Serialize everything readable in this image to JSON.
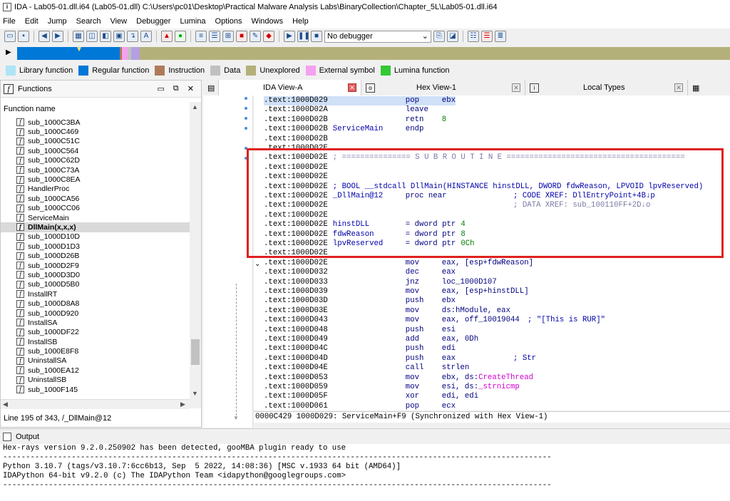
{
  "window": {
    "title": "IDA - Lab05-01.dll.i64 (Lab05-01.dll) C:\\Users\\pc01\\Desktop\\Practical Malware Analysis Labs\\BinaryCollection\\Chapter_5L\\Lab05-01.dll.i64"
  },
  "menu": [
    "File",
    "Edit",
    "Jump",
    "Search",
    "View",
    "Debugger",
    "Lumina",
    "Options",
    "Windows",
    "Help"
  ],
  "toolbar": {
    "debugger_select": "No debugger"
  },
  "legend": [
    {
      "label": "Library function",
      "color": "#aee4f5"
    },
    {
      "label": "Regular function",
      "color": "#0078d7"
    },
    {
      "label": "Instruction",
      "color": "#b07a5a"
    },
    {
      "label": "Data",
      "color": "#c0c0c0"
    },
    {
      "label": "Unexplored",
      "color": "#b4b07a"
    },
    {
      "label": "External symbol",
      "color": "#f5a0f0"
    },
    {
      "label": "Lumina function",
      "color": "#34c934"
    }
  ],
  "functions": {
    "title": "Functions",
    "column": "Function name",
    "items": [
      "sub_1000C3BA",
      "sub_1000C469",
      "sub_1000C51C",
      "sub_1000C564",
      "sub_1000C62D",
      "sub_1000C73A",
      "sub_1000C8EA",
      "HandlerProc",
      "sub_1000CA56",
      "sub_1000CC06",
      "ServiceMain",
      "DllMain(x,x,x)",
      "sub_1000D10D",
      "sub_1000D1D3",
      "sub_1000D26B",
      "sub_1000D2F9",
      "sub_1000D3D0",
      "sub_1000D5B0",
      "InstallRT",
      "sub_1000D8A8",
      "sub_1000D920",
      "InstallSA",
      "sub_1000DF22",
      "InstallSB",
      "sub_1000E8F8",
      "UninstallSA",
      "sub_1000EA12",
      "UninstallSB",
      "sub_1000F145"
    ],
    "selected_index": 11,
    "status": "Line 195 of 343, /_DllMain@12"
  },
  "tabs": [
    {
      "label": "IDA View-A",
      "active": true
    },
    {
      "label": "Hex View-1",
      "active": false
    },
    {
      "label": "Local Types",
      "active": false
    }
  ],
  "code": {
    "lines": [
      {
        "addr": ".text:1000D029",
        "label": "",
        "mn": "pop",
        "op": "ebx",
        "cm": ""
      },
      {
        "addr": ".text:1000D02A",
        "label": "",
        "mn": "leave",
        "op": "",
        "cm": ""
      },
      {
        "addr": ".text:1000D02B",
        "label": "",
        "mn": "retn",
        "op": "8",
        "cm": ""
      },
      {
        "addr": ".text:1000D02B",
        "label": "ServiceMain",
        "mn": "endp",
        "op": "",
        "cm": ""
      },
      {
        "addr": ".text:1000D02B",
        "label": "",
        "mn": "",
        "op": "",
        "cm": ""
      },
      {
        "addr": ".text:1000D02E",
        "label": "",
        "mn": "",
        "op": "",
        "cm": ""
      },
      {
        "addr": ".text:1000D02E",
        "label": "",
        "mn": "",
        "op": "",
        "cm": "",
        "sub": "; =============== S U B R O U T I N E ======================================="
      },
      {
        "addr": ".text:1000D02E",
        "label": "",
        "mn": "",
        "op": "",
        "cm": ""
      },
      {
        "addr": ".text:1000D02E",
        "label": "",
        "mn": "",
        "op": "",
        "cm": ""
      },
      {
        "addr": ".text:1000D02E",
        "label": "",
        "mn": "",
        "op": "",
        "cm": "",
        "sub": "; BOOL __stdcall DllMain(HINSTANCE hinstDLL, DWORD fdwReason, LPVOID lpvReserved)"
      },
      {
        "addr": ".text:1000D02E",
        "label": "_DllMain@12",
        "mn": "proc near",
        "op": "",
        "cm": "; CODE XREF: DllEntryPoint+4B↓p"
      },
      {
        "addr": ".text:1000D02E",
        "label": "",
        "mn": "",
        "op": "",
        "cm": "; DATA XREF: sub_100110FF+2D↓o"
      },
      {
        "addr": ".text:1000D02E",
        "label": "",
        "mn": "",
        "op": "",
        "cm": ""
      },
      {
        "addr": ".text:1000D02E",
        "label": "hinstDLL",
        "mn": "= dword ptr",
        "op": "4",
        "cm": ""
      },
      {
        "addr": ".text:1000D02E",
        "label": "fdwReason",
        "mn": "= dword ptr",
        "op": "8",
        "cm": ""
      },
      {
        "addr": ".text:1000D02E",
        "label": "lpvReserved",
        "mn": "= dword ptr",
        "op": "0Ch",
        "cm": ""
      },
      {
        "addr": ".text:1000D02E",
        "label": "",
        "mn": "",
        "op": "",
        "cm": ""
      },
      {
        "addr": ".text:1000D02E",
        "label": "",
        "mn": "mov",
        "op": "eax, [esp+fdwReason]",
        "cm": ""
      },
      {
        "addr": ".text:1000D032",
        "label": "",
        "mn": "dec",
        "op": "eax",
        "cm": ""
      },
      {
        "addr": ".text:1000D033",
        "label": "",
        "mn": "jnz",
        "op": "loc_1000D107",
        "cm": ""
      },
      {
        "addr": ".text:1000D039",
        "label": "",
        "mn": "mov",
        "op": "eax, [esp+hinstDLL]",
        "cm": ""
      },
      {
        "addr": ".text:1000D03D",
        "label": "",
        "mn": "push",
        "op": "ebx",
        "cm": ""
      },
      {
        "addr": ".text:1000D03E",
        "label": "",
        "mn": "mov",
        "op": "ds:hModule, eax",
        "cm": ""
      },
      {
        "addr": ".text:1000D043",
        "label": "",
        "mn": "mov",
        "op": "eax, off_10019044",
        "cm": "; \"[This is RUR]\""
      },
      {
        "addr": ".text:1000D048",
        "label": "",
        "mn": "push",
        "op": "esi",
        "cm": ""
      },
      {
        "addr": ".text:1000D049",
        "label": "",
        "mn": "add",
        "op": "eax, 0Dh",
        "cm": ""
      },
      {
        "addr": ".text:1000D04C",
        "label": "",
        "mn": "push",
        "op": "edi",
        "cm": ""
      },
      {
        "addr": ".text:1000D04D",
        "label": "",
        "mn": "push",
        "op": "eax",
        "cm": "; Str"
      },
      {
        "addr": ".text:1000D04E",
        "label": "",
        "mn": "call",
        "op": "strlen",
        "cm": ""
      },
      {
        "addr": ".text:1000D053",
        "label": "",
        "mn": "mov",
        "op": "ebx, ds:CreateThread",
        "cm": ""
      },
      {
        "addr": ".text:1000D059",
        "label": "",
        "mn": "mov",
        "op": "esi, ds:_strnicmp",
        "cm": ""
      },
      {
        "addr": ".text:1000D05F",
        "label": "",
        "mn": "xor",
        "op": "edi, edi",
        "cm": ""
      },
      {
        "addr": ".text:1000D061",
        "label": "",
        "mn": "pop",
        "op": "ecx",
        "cm": ""
      }
    ],
    "status": "0000C429 1000D029: ServiceMain+F9 (Synchronized with Hex View-1)"
  },
  "output": {
    "title": "Output",
    "lines": [
      "Hex-rays version 9.2.0.250902 has been detected, gooMBA plugin ready to use",
      "------------------------------------------------------------------------------------------------------------------------",
      "Python 3.10.7 (tags/v3.10.7:6cc6b13, Sep  5 2022, 14:08:36) [MSC v.1933 64 bit (AMD64)]",
      "IDAPython 64-bit v9.2.0 (c) The IDAPython Team <idapython@googlegroups.com>",
      "------------------------------------------------------------------------------------------------------------------------"
    ]
  }
}
